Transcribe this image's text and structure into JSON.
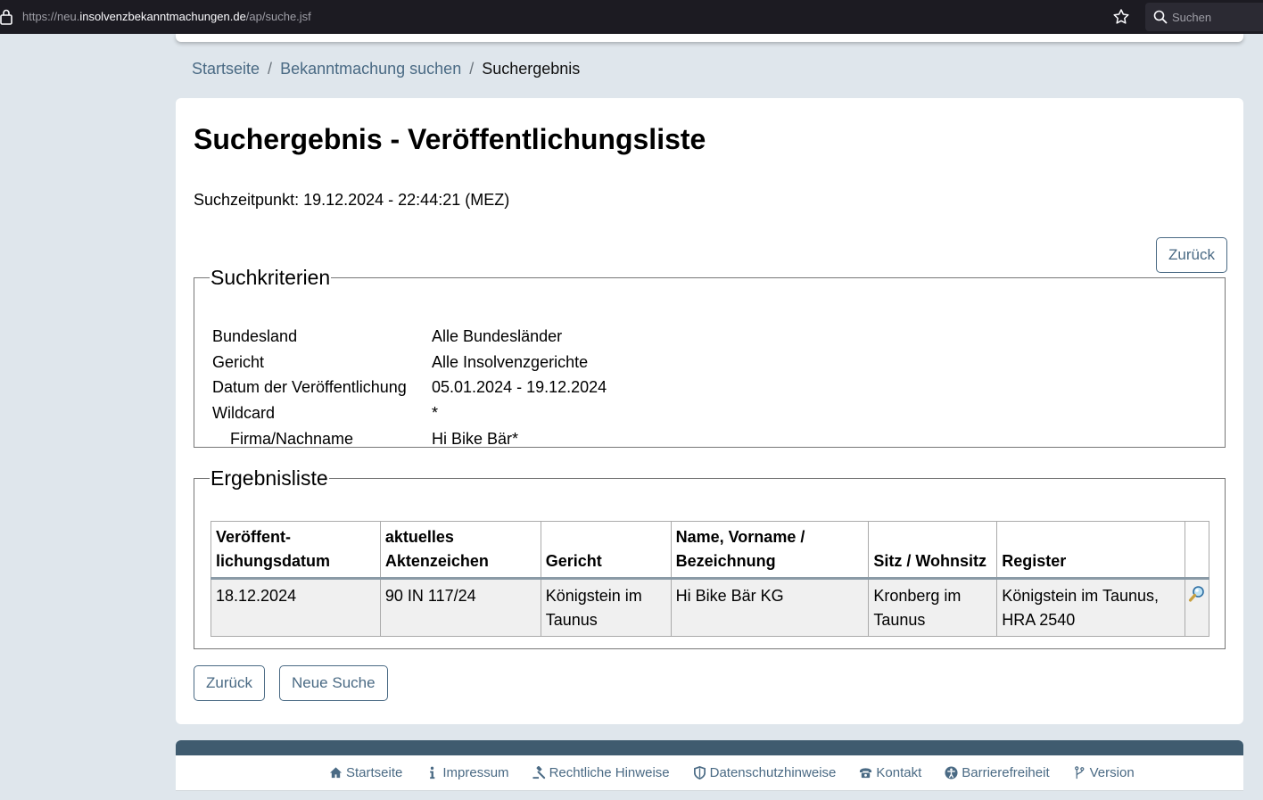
{
  "browser": {
    "url_prefix": "https://neu.",
    "url_host": "insolvenzbekanntmachungen.de",
    "url_path": "/ap/suche.jsf",
    "search_placeholder": "Suchen"
  },
  "breadcrumb": {
    "home": "Startseite",
    "search": "Bekanntmachung suchen",
    "current": "Suchergebnis",
    "separator": "/"
  },
  "main": {
    "title": "Suchergebnis - Veröffentlichungsliste",
    "search_time": "Suchzeitpunkt: 19.12.2024 - 22:44:21 (MEZ)",
    "back_label": "Zurück",
    "new_search_label": "Neue Suche"
  },
  "criteria": {
    "legend": "Suchkriterien",
    "rows": [
      {
        "label": "Bundesland",
        "value": "Alle Bundesländer"
      },
      {
        "label": "Gericht",
        "value": "Alle Insolvenzgerichte"
      },
      {
        "label": "Datum der Veröffentlichung",
        "value": "05.01.2024 - 19.12.2024"
      },
      {
        "label": "Wildcard",
        "value": "*"
      },
      {
        "label": "Firma/Nachname",
        "value": "Hi Bike Bär*"
      }
    ]
  },
  "results": {
    "legend": "Ergebnisliste",
    "headers": [
      {
        "line1": "Veröffent-",
        "line2": "lichungsdatum"
      },
      {
        "line1": "aktuelles",
        "line2": "Aktenzeichen"
      },
      {
        "line1": "",
        "line2": "Gericht"
      },
      {
        "line1": "Name, Vorname /",
        "line2": "Bezeichnung"
      },
      {
        "line1": "",
        "line2": "Sitz / Wohnsitz"
      },
      {
        "line1": "",
        "line2": "Register"
      }
    ],
    "rows": [
      {
        "date": "18.12.2024",
        "file_number": "90 IN 117/24",
        "court": "Königstein im Taunus",
        "name": "Hi Bike Bär KG",
        "seat": "Kronberg im Taunus",
        "register": "Königstein im Taunus, HRA 2540",
        "action_icon": "magnifier-icon"
      }
    ]
  },
  "footer": {
    "links": [
      {
        "label": "Startseite",
        "icon": "home-icon"
      },
      {
        "label": "Impressum",
        "icon": "info-icon"
      },
      {
        "label": "Rechtliche Hinweise",
        "icon": "gavel-icon"
      },
      {
        "label": "Datenschutzhinweise",
        "icon": "shield-icon"
      },
      {
        "label": "Kontakt",
        "icon": "phone-icon"
      },
      {
        "label": "Barrierefreiheit",
        "icon": "accessibility-icon"
      },
      {
        "label": "Version",
        "icon": "branch-icon"
      }
    ]
  },
  "colors": {
    "link": "#4a6a84",
    "footer_band": "#3f5b6f",
    "page_bg": "#dfe6ec"
  }
}
